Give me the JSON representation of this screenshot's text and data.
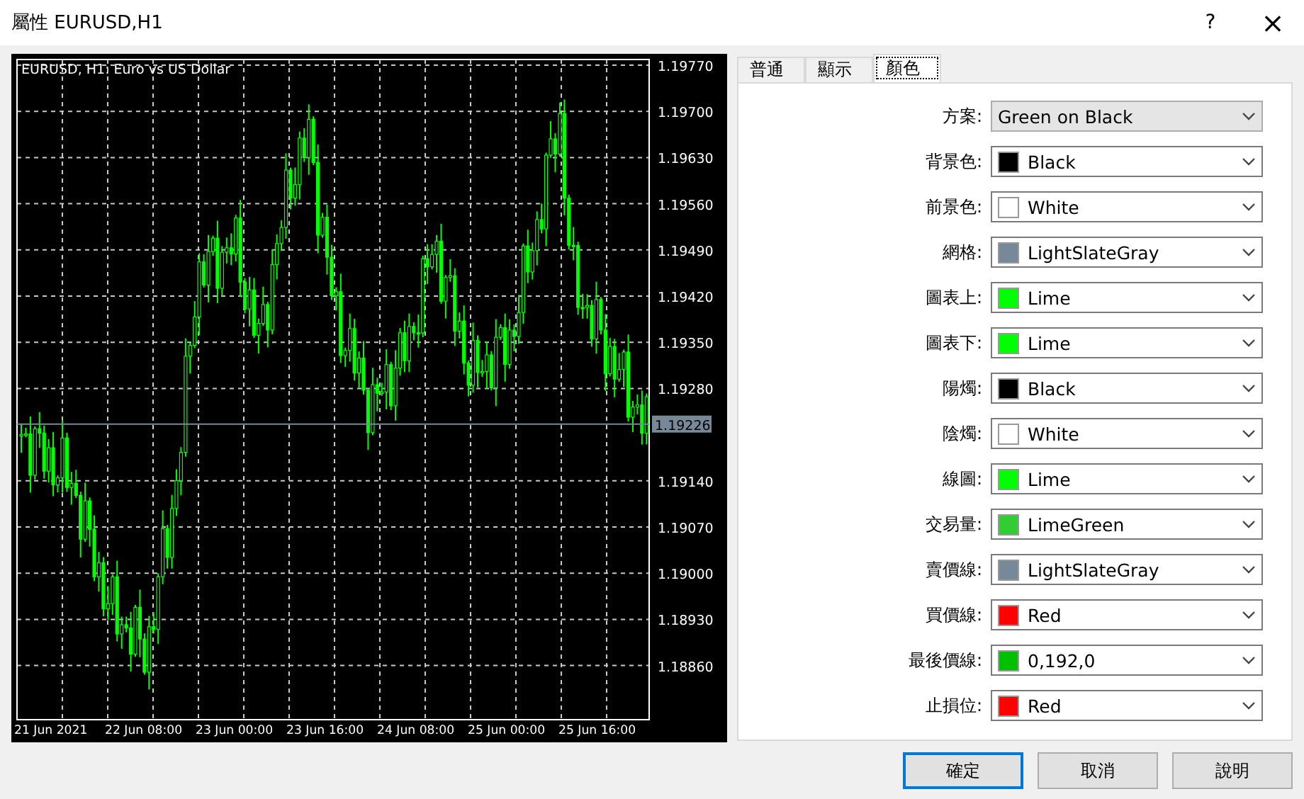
{
  "window": {
    "title": "屬性 EURUSD,H1",
    "buttons": [
      {
        "label": "?",
        "kind": "help"
      },
      {
        "label": "×",
        "kind": "close"
      }
    ]
  },
  "chart": {
    "title": "EURUSD, H1: Euro vs US Dollar",
    "price_labels": [
      "1.19770",
      "1.19700",
      "1.19630",
      "1.19560",
      "1.19490",
      "1.19420",
      "1.19350",
      "1.19280",
      "1.19140",
      "1.19070",
      "1.19000",
      "1.18930",
      "1.18860"
    ],
    "current_price": "1.19226",
    "time_labels": [
      "21 Jun 2021",
      "22 Jun 08:00",
      "23 Jun 00:00",
      "23 Jun 16:00",
      "24 Jun 08:00",
      "25 Jun 00:00",
      "25 Jun 16:00"
    ]
  },
  "tabs": [
    {
      "label": "普通",
      "selected": false
    },
    {
      "label": "顯示",
      "selected": false
    },
    {
      "label": "顏色",
      "selected": true
    }
  ],
  "color_settings": [
    {
      "label": "方案:",
      "value": "Green on Black",
      "kind": "scheme"
    },
    {
      "label": "背景色:",
      "value": "Black",
      "kind": "color",
      "color": "#000000"
    },
    {
      "label": "前景色:",
      "value": "White",
      "kind": "color",
      "color": "#ffffff"
    },
    {
      "label": "網格:",
      "value": "LightSlateGray",
      "kind": "color",
      "color": "#778899"
    },
    {
      "label": "圖表上:",
      "value": "Lime",
      "kind": "color",
      "color": "#00ff00"
    },
    {
      "label": "圖表下:",
      "value": "Lime",
      "kind": "color",
      "color": "#00ff00"
    },
    {
      "label": "陽燭:",
      "value": "Black",
      "kind": "color",
      "color": "#000000"
    },
    {
      "label": "陰燭:",
      "value": "White",
      "kind": "color",
      "color": "#ffffff"
    },
    {
      "label": "線圖:",
      "value": "Lime",
      "kind": "color",
      "color": "#00ff00"
    },
    {
      "label": "交易量:",
      "value": "LimeGreen",
      "kind": "color",
      "color": "#32cd32"
    },
    {
      "label": "賣價線:",
      "value": "LightSlateGray",
      "kind": "color",
      "color": "#778899"
    },
    {
      "label": "買價線:",
      "value": "Red",
      "kind": "color",
      "color": "#ff0000"
    },
    {
      "label": "最後價線:",
      "value": "0,192,0",
      "kind": "color",
      "color": "#00c000"
    },
    {
      "label": "止損位:",
      "value": "Red",
      "kind": "color",
      "color": "#ff0000"
    }
  ],
  "buttons": [
    {
      "label": "確定",
      "default": true
    },
    {
      "label": "取消",
      "default": false
    },
    {
      "label": "說明",
      "default": false
    }
  ]
}
